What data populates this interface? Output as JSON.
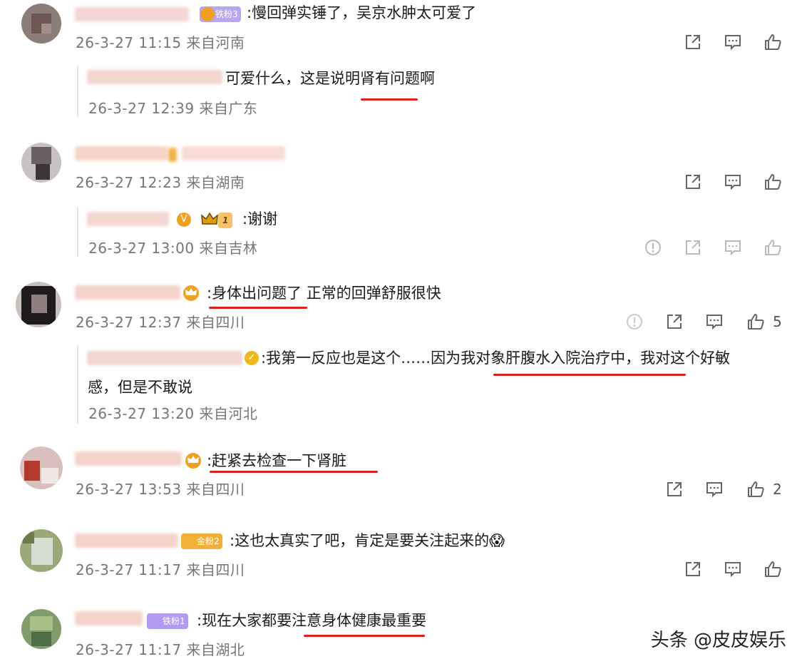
{
  "comments": [
    {
      "text": ":慢回弹实锤了，吴京水肿太可爱了",
      "meta": "26-3-27 11:15 来自河南",
      "badge": "铁粉3",
      "reply": {
        "text": "可爱什么，这是说明肾有问题啊",
        "meta": "26-3-27 12:39 来自广东"
      }
    },
    {
      "text": "",
      "meta": "26-3-27 12:23 来自湖南",
      "reply": {
        "text": ":谢谢",
        "meta": "26-3-27 13:00 来自吉林",
        "level": "1"
      }
    },
    {
      "text": ":身体出问题了 正常的回弹舒服很快",
      "meta": "26-3-27 12:37 来自四川",
      "likes": "5",
      "reply": {
        "text": ":我第一反应也是这个……因为我对象肝腹水入院治疗中，我对这个好敏",
        "text2": "感，但是不敢说",
        "meta": "26-3-27 13:20 来自河北"
      }
    },
    {
      "text": ":赶紧去检查一下肾脏",
      "meta": "26-3-27 13:53 来自四川",
      "likes": "2"
    },
    {
      "text": ":这也太真实了吧，肯定是要关注起来的😱",
      "meta": "26-3-27 11:17 来自四川",
      "badge": "金粉2"
    },
    {
      "text": ":现在大家都要注意身体健康最重要",
      "meta": "26-3-27 11:17 来自湖北",
      "badge": "铁粉1"
    }
  ],
  "watermark": "头条 @皮皮娱乐",
  "colors": {
    "underline": "#d9201a",
    "meta": "#777777",
    "badge": "#f0a020"
  },
  "icons": [
    "share-icon",
    "comment-icon",
    "like-icon",
    "report-icon"
  ]
}
